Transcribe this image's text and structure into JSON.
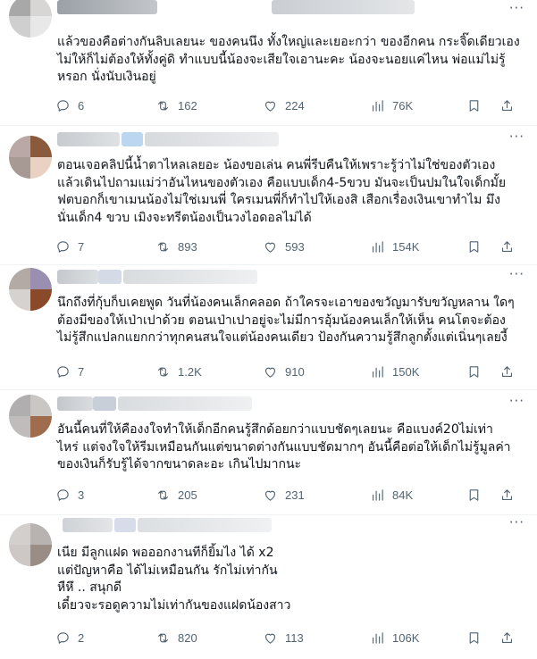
{
  "tweets": [
    {
      "lines": [
        "แล้วของคือต่างกันลิบเลยนะ ของคนนึง ทั้งใหญ่และเยอะกว่า ของอีกคน กระจิ๊ดเดียวเอง",
        "ไม่ให้ก็ไม่ต้องให้ทั้งคู่ดิ ทำแบบนี้น้องจะเสียใจเอานะคะ น้องจะนอยแค่ไหน พ่อแม่ไม่รู้",
        "หรอก นั่งนับเงินอยู่"
      ],
      "stats": {
        "replies": "6",
        "reposts": "162",
        "likes": "224",
        "views": "76K"
      }
    },
    {
      "lines": [
        "ตอนเจอคลิปนี้น้ำตาไหลเลยอะ น้องขอเล่น คนพี่รีบคืนให้เพราะรู้ว่าไม่ใช่ของตัวเอง",
        "แล้วเดินไปถามแม่ว่าอันไหนของตัวเอง คือแบบเด็ก4-5ขวบ มันจะเป็นปมในใจเด็กมั้ย",
        "ฟตบอกก็เขาเมนน้องไม่ใช่เมนพี่ ใครเมนพี่ก็ทำไปให้เองสิ เสือกเรื่องเงินเขาทำไม มึง",
        "นั่นเด็ก4 ขวบ เมิงจะทรีตน้องเป็นวงไอดอลไม่ได้"
      ],
      "stats": {
        "replies": "7",
        "reposts": "893",
        "likes": "593",
        "views": "154K"
      }
    },
    {
      "lines": [
        "นึกถึงที่กุ้บก็บเคยพูด วันที่น้องคนเล็กคลอด ถ้าใครจะเอาของขวัญมารับขวัญหลาน ใดๆ",
        "ต้องมีของให้เป่าเปาด้วย ตอนเป่าเปาอยู่จะไม่มีการอุ้มน้องคนเล็กให้เห็น คนโตจะต้อง",
        "ไม่รู้สึกแปลกแยกกว่าทุกคนสนใจแต่น้องคนเดียว ป้องกันความรู้สึกลูกตั้งแต่เนิ่นๆเลยงี้"
      ],
      "stats": {
        "replies": "7",
        "reposts": "1.2K",
        "likes": "910",
        "views": "150K"
      }
    },
    {
      "lines": [
        "อันนี้คนที่ให้คืองงใจทำให้เด็กอีกคนรู้สึกด้อยกว่าแบบชัดๆเลยนะ คือแบงค์20ไม่เท่า",
        "ไหร่ แต่จงใจให้รีมเหมือนกันแต่ขนาดต่างกันแบบชัดมากๆ อันนี้คือต่อให้เด็กไม่รู้มูลค่า",
        "ของเงินก็รับรู้ได้จากขนาดละอะ เกินไปมากนะ"
      ],
      "stats": {
        "replies": "3",
        "reposts": "205",
        "likes": "231",
        "views": "84K"
      }
    },
    {
      "lines": [
        "เนีย มีลูกแฝด พอออกงานทีก็ยิ้มไง ได้ x2",
        "แต่ปัญหาคือ ได้ไม่เหมือนกัน รักไม่เท่ากัน",
        "หืหึ .. สนุกดี",
        "เดี๋ยวจะรอดูความไม่เท่ากันของแฝดน้องสาว"
      ],
      "stats": {
        "replies": "2",
        "reposts": "820",
        "likes": "113",
        "views": "106K"
      }
    }
  ],
  "more_label": "···",
  "icons": [
    "reply-icon",
    "repost-icon",
    "like-icon",
    "views-icon",
    "bookmark-icon",
    "share-icon"
  ],
  "colors": {
    "text": "#0f1419",
    "muted": "#536471",
    "divider": "#eff3f4"
  }
}
